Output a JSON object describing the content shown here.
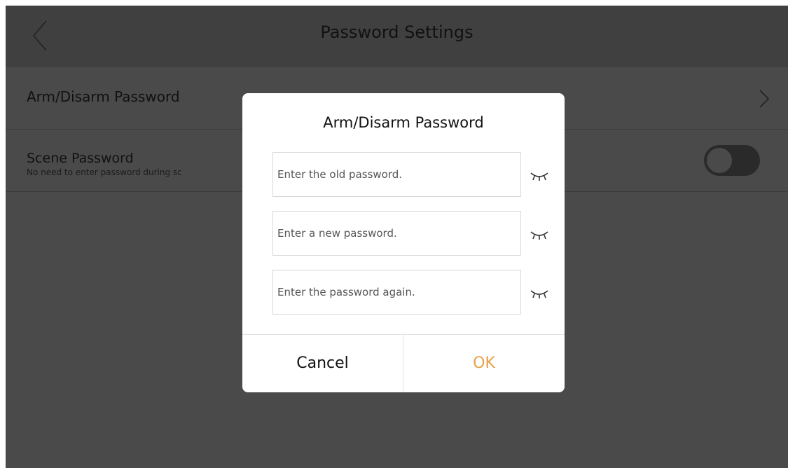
{
  "header": {
    "title": "Password Settings"
  },
  "rows": [
    {
      "label": "Arm/Disarm Password"
    },
    {
      "label": "Scene Password",
      "sublabel": "No need to enter password during sc"
    }
  ],
  "scene_toggle": {
    "on": false
  },
  "dialog": {
    "title": "Arm/Disarm Password",
    "fields": [
      {
        "placeholder": "Enter the old password.",
        "value": ""
      },
      {
        "placeholder": "Enter a new password.",
        "value": ""
      },
      {
        "placeholder": "Enter the password again.",
        "value": ""
      }
    ],
    "cancel_label": "Cancel",
    "ok_label": "OK"
  },
  "icons": {
    "back": "chevron-left-icon",
    "row_arrow": "chevron-right-icon",
    "password_visibility": "eye-closed-icon"
  },
  "colors": {
    "accent": "#e8a14a",
    "overlay_background": "#4a4a4a",
    "header_background": "#404040",
    "dialog_background": "#ffffff"
  }
}
